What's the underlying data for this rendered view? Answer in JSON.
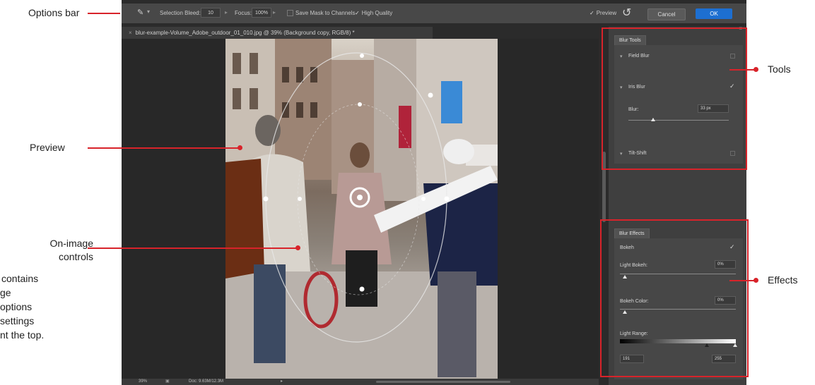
{
  "callouts": {
    "options_bar": "Options bar",
    "preview": "Preview",
    "on_image_line1": "On-image",
    "on_image_line2": "controls",
    "tools": "Tools",
    "effects": "Effects",
    "cut_text": [
      "contains",
      "ge",
      "options",
      "settings",
      "nt the top."
    ]
  },
  "options_bar": {
    "selection_bleed_label": "Selection Bleed:",
    "selection_bleed_value": "10",
    "focus_label": "Focus:",
    "focus_value": "100%",
    "save_mask_label": "Save Mask to Channels",
    "high_quality_label": "High Quality",
    "preview_label": "Preview",
    "cancel_label": "Cancel",
    "ok_label": "OK",
    "accent": "#1d6fd1"
  },
  "document": {
    "tab_title": "blur-example-Volume_Adobe_outdoor_01_010.jpg @ 39% (Background copy, RGB/8) *",
    "zoom": "39%",
    "doc_info": "Doc: 9.63M/12.3M"
  },
  "blur_tools": {
    "tab": "Blur Tools",
    "field_blur": "Field Blur",
    "iris_blur": "Iris Blur",
    "blur_label": "Blur:",
    "blur_value": "33 px",
    "tilt_shift": "Tilt-Shift"
  },
  "blur_effects": {
    "tab": "Blur Effects",
    "bokeh": "Bokeh",
    "light_bokeh_label": "Light Bokeh:",
    "light_bokeh_value": "0%",
    "bokeh_color_label": "Bokeh Color:",
    "bokeh_color_value": "0%",
    "light_range_label": "Light Range:",
    "light_range_low": "191",
    "light_range_high": "255"
  },
  "colors": {
    "callout_red": "#d8232a",
    "app_bg": "#2b2b2b",
    "panel_bg": "#3f3f3f"
  }
}
